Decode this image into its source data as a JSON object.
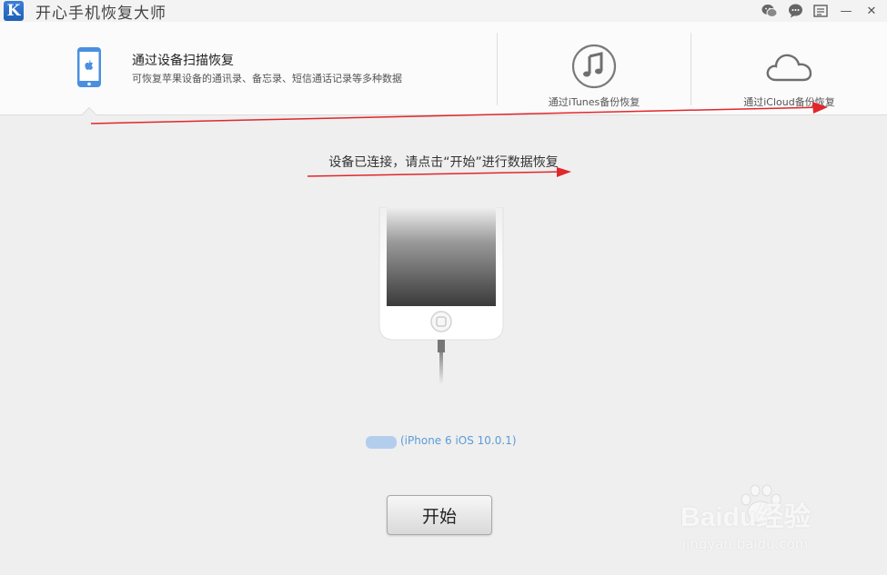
{
  "app": {
    "logo_letter": "K",
    "title": "开心手机恢复大师"
  },
  "window_controls": [
    {
      "name": "wechat-icon"
    },
    {
      "name": "chat-icon"
    },
    {
      "name": "menu-icon"
    },
    {
      "name": "minimize-icon",
      "glyph": "—"
    },
    {
      "name": "close-icon",
      "glyph": "✕"
    }
  ],
  "tabs": {
    "scan": {
      "title": "通过设备扫描恢复",
      "description": "可恢复苹果设备的通讯录、备忘录、短信通话记录等多种数据",
      "icon": "iphone-icon"
    },
    "itunes": {
      "label": "通过iTunes备份恢复",
      "icon": "music-note-icon"
    },
    "icloud": {
      "label": "通过iCloud备份恢复",
      "icon": "cloud-icon"
    }
  },
  "main": {
    "status": "设备已连接，请点击“开始”进行数据恢复",
    "device_info": "(iPhone 6 iOS 10.0.1)",
    "start_button": "开始"
  },
  "watermark": {
    "brand": "Baidu经验",
    "url": "jingyan.baidu.com"
  },
  "colors": {
    "accent_blue": "#4a8fe0",
    "annotation_red": "#e0272b",
    "device_text": "#5b9bd8"
  }
}
